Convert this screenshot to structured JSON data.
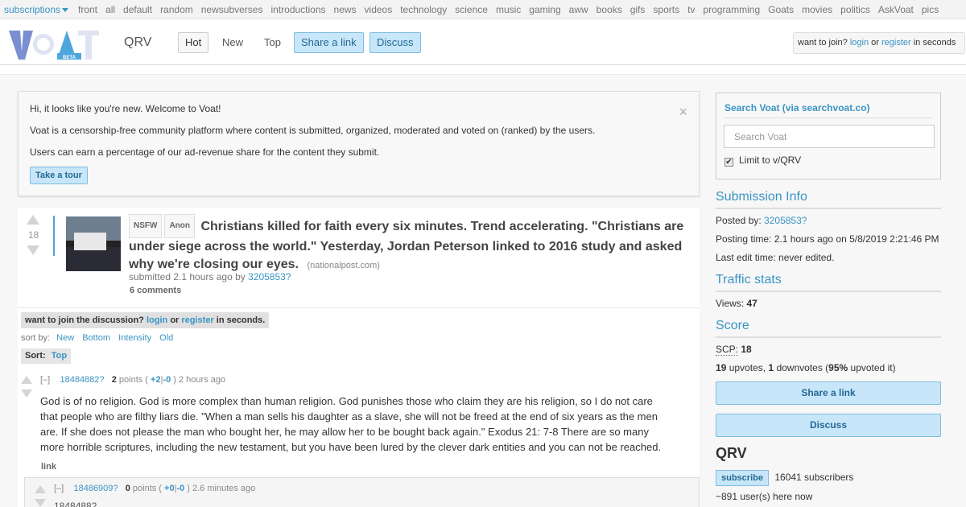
{
  "subbar": {
    "subscriptions": "subscriptions",
    "links": [
      "front",
      "all",
      "default",
      "random",
      "newsubverses",
      "introductions",
      "news",
      "videos",
      "technology",
      "science",
      "music",
      "gaming",
      "aww",
      "books",
      "gifs",
      "sports",
      "tv",
      "programming",
      "Goats",
      "movies",
      "politics",
      "AskVoat",
      "pics"
    ]
  },
  "header": {
    "subverse": "QRV",
    "tabs": {
      "hot": "Hot",
      "new": "New",
      "top": "Top"
    },
    "share_label": "Share a link",
    "discuss_label": "Discuss",
    "join": {
      "prefix": "want to join?",
      "login": "login",
      "or": "or",
      "register": "register",
      "suffix": "in seconds"
    }
  },
  "welcome": {
    "line1": "Hi, it looks like you're new. Welcome to Voat!",
    "line2": "Voat is a censorship-free community platform where content is submitted, organized, moderated and voted on (ranked) by the users.",
    "line3": "Users can earn a percentage of our ad-revenue share for the content they submit.",
    "tour_label": "Take a tour",
    "close": "×"
  },
  "post": {
    "score": "18",
    "tags": [
      "NSFW",
      "Anon"
    ],
    "title": "Christians killed for faith every six minutes. Trend accelerating. \"Christians are under siege across the world.\" Yesterday, Jordan Peterson linked to 2016 study and asked why we're closing our eyes.",
    "domain": "(nationalpost.com)",
    "submitted": "submitted 2.1 hours ago by",
    "author": "3205853?",
    "comments": "6 comments"
  },
  "discussion": {
    "join_prefix": "want to join the discussion?",
    "login": "login",
    "or": "or",
    "register": "register",
    "suffix": "in seconds.",
    "sort_label": "sort by:",
    "sort_options": [
      "New",
      "Bottom",
      "Intensity",
      "Old"
    ],
    "sort_current_label": "Sort:",
    "sort_current": "Top"
  },
  "comment1": {
    "collapse": "[–]",
    "user": "18484882?",
    "points": "2",
    "points_word": "points",
    "up": "+2",
    "down": "-0",
    "time": "2 hours ago",
    "body": "God is of no religion. God is more complex than human religion. God punishes those who claim they are his religion, so I do not care that people who are filthy liars die. \"When a man sells his daughter as a slave, she will not be freed at the end of six years as the men are. If she does not please the man who bought her, he may allow her to be bought back again.\" Exodus 21: 7-8 There are so many more horrible scriptures, including the new testament, but you have been lured by the clever dark entities and you can not be reached.",
    "link": "link"
  },
  "comment2": {
    "collapse": "[–]",
    "user": "18486909?",
    "points": "0",
    "points_word": "points",
    "up": "+0",
    "down": "-0",
    "time": "2.6 minutes ago",
    "body_fragment": "18484882 … "
  },
  "sidebar": {
    "search_head": "Search Voat (via searchvoat.co)",
    "search_placeholder": "Search Voat",
    "limit_label": "Limit to v/QRV",
    "submission_info": "Submission Info",
    "posted_by_label": "Posted by:",
    "posted_by": "3205853?",
    "posting_time": "Posting time: 2.1 hours ago on 5/8/2019 2:21:46 PM",
    "last_edit": "Last edit time: never edited.",
    "traffic_stats": "Traffic stats",
    "views_label": "Views:",
    "views": "47",
    "score_head": "Score",
    "scp_label": "SCP:",
    "scp": "18",
    "upvotes": "19",
    "upvotes_word": "upvotes,",
    "downvotes": "1",
    "downvotes_word": "downvotes (",
    "upvoted_pct": "95%",
    "upvoted_suffix": "upvoted it)",
    "share_label": "Share a link",
    "discuss_label": "Discuss",
    "subverse": "QRV",
    "subscribe_label": "subscribe",
    "subscribers": "16041 subscribers",
    "online": "~891 user(s) here now"
  },
  "colors": {
    "accent": "#3a94c4",
    "button_bg": "#c8e6f9",
    "button_border": "#7fbde0"
  }
}
